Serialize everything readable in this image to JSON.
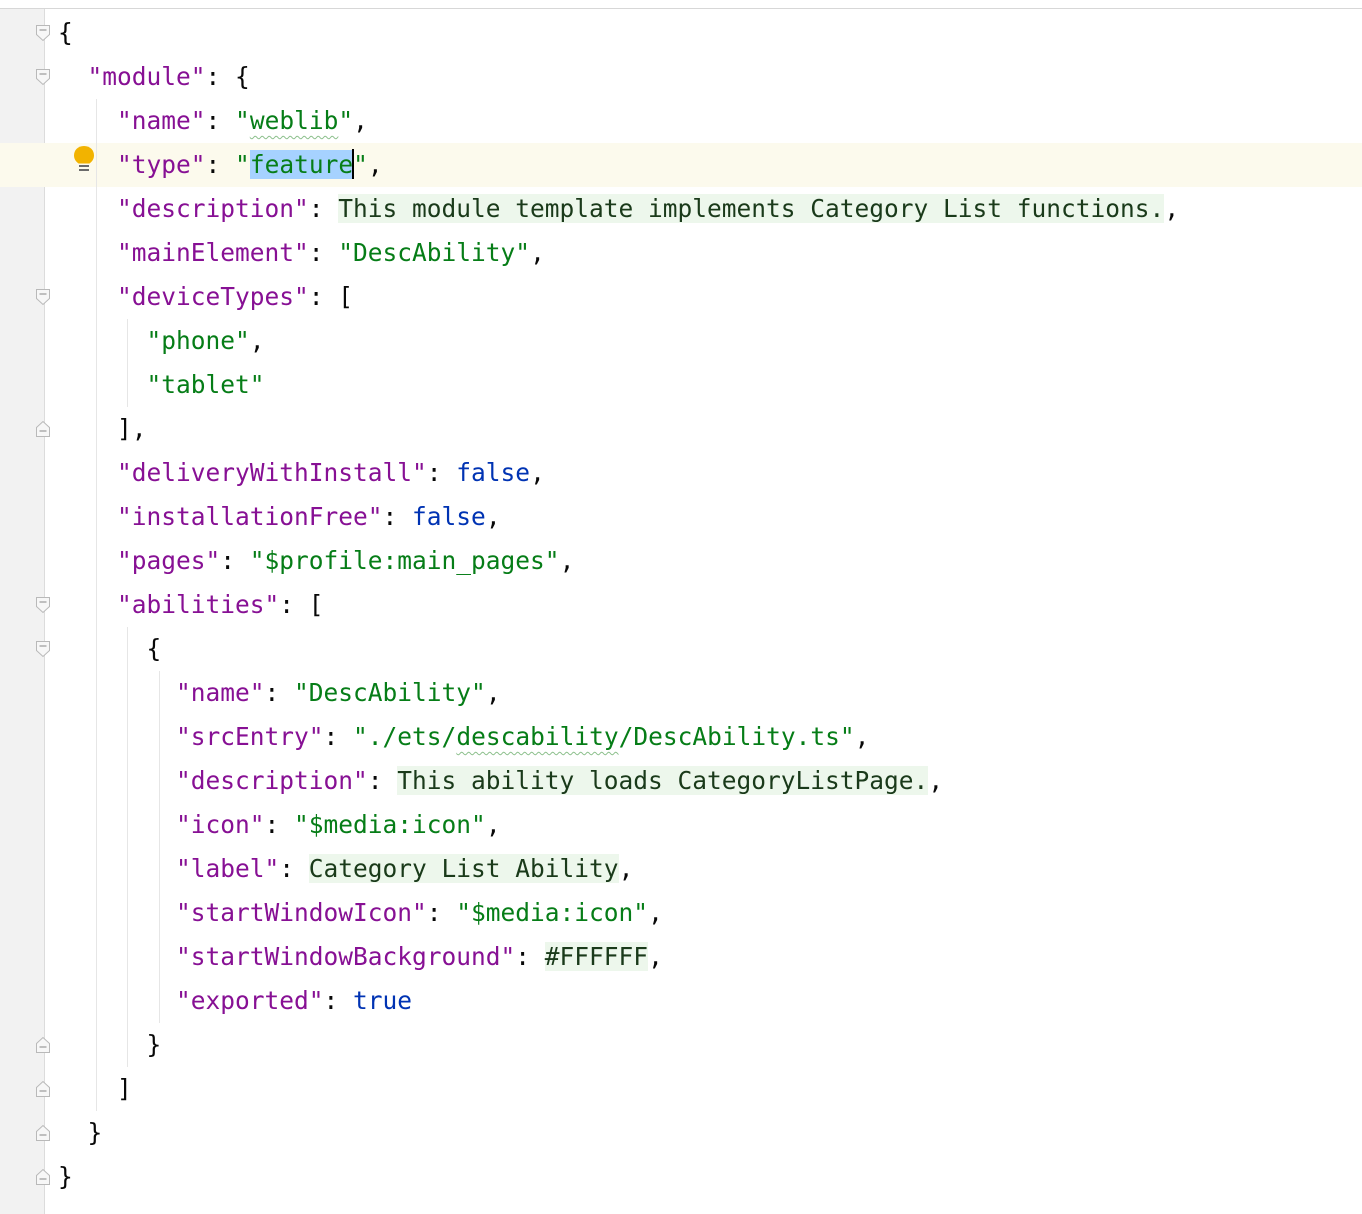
{
  "editor": {
    "file_type": "json5",
    "lines": [
      {
        "tokens": [
          {
            "t": "{",
            "c": "p"
          }
        ]
      },
      {
        "tokens": [
          {
            "t": "  ",
            "c": "p"
          },
          {
            "t": "\"module\"",
            "c": "k"
          },
          {
            "t": ": {",
            "c": "p"
          }
        ]
      },
      {
        "tokens": [
          {
            "t": "    ",
            "c": "p"
          },
          {
            "t": "\"name\"",
            "c": "k"
          },
          {
            "t": ": ",
            "c": "p"
          },
          {
            "t": "\"",
            "c": "s"
          },
          {
            "t": "weblib",
            "c": "s squig"
          },
          {
            "t": "\"",
            "c": "s"
          },
          {
            "t": ",",
            "c": "p"
          }
        ]
      },
      {
        "tokens": [
          {
            "t": "    ",
            "c": "p"
          },
          {
            "t": "\"type\"",
            "c": "k"
          },
          {
            "t": ": ",
            "c": "p"
          },
          {
            "t": "\"",
            "c": "s"
          },
          {
            "t": "feature",
            "c": "s sel"
          },
          {
            "t": "",
            "c": "caret"
          },
          {
            "t": "\"",
            "c": "s"
          },
          {
            "t": ",",
            "c": "p"
          }
        ]
      },
      {
        "tokens": [
          {
            "t": "    ",
            "c": "p"
          },
          {
            "t": "\"description\"",
            "c": "k"
          },
          {
            "t": ": ",
            "c": "p"
          },
          {
            "t": "This module template implements Category List functions.",
            "c": "inj"
          },
          {
            "t": ",",
            "c": "p"
          }
        ]
      },
      {
        "tokens": [
          {
            "t": "    ",
            "c": "p"
          },
          {
            "t": "\"mainElement\"",
            "c": "k"
          },
          {
            "t": ": ",
            "c": "p"
          },
          {
            "t": "\"DescAbility\"",
            "c": "s"
          },
          {
            "t": ",",
            "c": "p"
          }
        ]
      },
      {
        "tokens": [
          {
            "t": "    ",
            "c": "p"
          },
          {
            "t": "\"deviceTypes\"",
            "c": "k"
          },
          {
            "t": ": [",
            "c": "p"
          }
        ]
      },
      {
        "tokens": [
          {
            "t": "      ",
            "c": "p"
          },
          {
            "t": "\"phone\"",
            "c": "s"
          },
          {
            "t": ",",
            "c": "p"
          }
        ]
      },
      {
        "tokens": [
          {
            "t": "      ",
            "c": "p"
          },
          {
            "t": "\"tablet\"",
            "c": "s"
          }
        ]
      },
      {
        "tokens": [
          {
            "t": "    ],",
            "c": "p"
          }
        ]
      },
      {
        "tokens": [
          {
            "t": "    ",
            "c": "p"
          },
          {
            "t": "\"deliveryWithInstall\"",
            "c": "k"
          },
          {
            "t": ": ",
            "c": "p"
          },
          {
            "t": "false",
            "c": "b"
          },
          {
            "t": ",",
            "c": "p"
          }
        ]
      },
      {
        "tokens": [
          {
            "t": "    ",
            "c": "p"
          },
          {
            "t": "\"installationFree\"",
            "c": "k"
          },
          {
            "t": ": ",
            "c": "p"
          },
          {
            "t": "false",
            "c": "b"
          },
          {
            "t": ",",
            "c": "p"
          }
        ]
      },
      {
        "tokens": [
          {
            "t": "    ",
            "c": "p"
          },
          {
            "t": "\"pages\"",
            "c": "k"
          },
          {
            "t": ": ",
            "c": "p"
          },
          {
            "t": "\"$profile:main_pages\"",
            "c": "s"
          },
          {
            "t": ",",
            "c": "p"
          }
        ]
      },
      {
        "tokens": [
          {
            "t": "    ",
            "c": "p"
          },
          {
            "t": "\"abilities\"",
            "c": "k"
          },
          {
            "t": ": [",
            "c": "p"
          }
        ]
      },
      {
        "tokens": [
          {
            "t": "      {",
            "c": "p"
          }
        ]
      },
      {
        "tokens": [
          {
            "t": "        ",
            "c": "p"
          },
          {
            "t": "\"name\"",
            "c": "k"
          },
          {
            "t": ": ",
            "c": "p"
          },
          {
            "t": "\"DescAbility\"",
            "c": "s"
          },
          {
            "t": ",",
            "c": "p"
          }
        ]
      },
      {
        "tokens": [
          {
            "t": "        ",
            "c": "p"
          },
          {
            "t": "\"srcEntry\"",
            "c": "k"
          },
          {
            "t": ": ",
            "c": "p"
          },
          {
            "t": "\"./ets/",
            "c": "s"
          },
          {
            "t": "descability",
            "c": "s squig"
          },
          {
            "t": "/DescAbility.ts\"",
            "c": "s"
          },
          {
            "t": ",",
            "c": "p"
          }
        ]
      },
      {
        "tokens": [
          {
            "t": "        ",
            "c": "p"
          },
          {
            "t": "\"description\"",
            "c": "k"
          },
          {
            "t": ": ",
            "c": "p"
          },
          {
            "t": "This ability loads CategoryListPage.",
            "c": "inj"
          },
          {
            "t": ",",
            "c": "p"
          }
        ]
      },
      {
        "tokens": [
          {
            "t": "        ",
            "c": "p"
          },
          {
            "t": "\"icon\"",
            "c": "k"
          },
          {
            "t": ": ",
            "c": "p"
          },
          {
            "t": "\"$media:icon\"",
            "c": "s"
          },
          {
            "t": ",",
            "c": "p"
          }
        ]
      },
      {
        "tokens": [
          {
            "t": "        ",
            "c": "p"
          },
          {
            "t": "\"label\"",
            "c": "k"
          },
          {
            "t": ": ",
            "c": "p"
          },
          {
            "t": "Category List Ability",
            "c": "inj"
          },
          {
            "t": ",",
            "c": "p"
          }
        ]
      },
      {
        "tokens": [
          {
            "t": "        ",
            "c": "p"
          },
          {
            "t": "\"startWindowIcon\"",
            "c": "k"
          },
          {
            "t": ": ",
            "c": "p"
          },
          {
            "t": "\"$media:icon\"",
            "c": "s"
          },
          {
            "t": ",",
            "c": "p"
          }
        ]
      },
      {
        "tokens": [
          {
            "t": "        ",
            "c": "p"
          },
          {
            "t": "\"startWindowBackground\"",
            "c": "k"
          },
          {
            "t": ": ",
            "c": "p"
          },
          {
            "t": "#FFFFFF",
            "c": "inj"
          },
          {
            "t": ",",
            "c": "p"
          }
        ]
      },
      {
        "tokens": [
          {
            "t": "        ",
            "c": "p"
          },
          {
            "t": "\"exported\"",
            "c": "k"
          },
          {
            "t": ": ",
            "c": "p"
          },
          {
            "t": "true",
            "c": "b"
          }
        ]
      },
      {
        "tokens": [
          {
            "t": "      }",
            "c": "p"
          }
        ]
      },
      {
        "tokens": [
          {
            "t": "    ]",
            "c": "p"
          }
        ]
      },
      {
        "tokens": [
          {
            "t": "  }",
            "c": "p"
          }
        ]
      },
      {
        "tokens": [
          {
            "t": "}",
            "c": "p"
          }
        ]
      }
    ],
    "fold_markers": [
      {
        "line": 0,
        "kind": "open"
      },
      {
        "line": 1,
        "kind": "open"
      },
      {
        "line": 6,
        "kind": "open"
      },
      {
        "line": 9,
        "kind": "close"
      },
      {
        "line": 13,
        "kind": "open"
      },
      {
        "line": 14,
        "kind": "open"
      },
      {
        "line": 23,
        "kind": "close"
      },
      {
        "line": 24,
        "kind": "close"
      },
      {
        "line": 25,
        "kind": "close"
      },
      {
        "line": 26,
        "kind": "close"
      }
    ],
    "indent_guides": [
      {
        "col": 2,
        "from": 2,
        "to": 25
      },
      {
        "col": 4,
        "from": 7,
        "to": 9
      },
      {
        "col": 4,
        "from": 14,
        "to": 24
      },
      {
        "col": 6,
        "from": 15,
        "to": 23
      }
    ],
    "caret_line": 3,
    "intention_icon": "lightbulb-icon",
    "colors": {
      "key": "#871094",
      "string": "#067d17",
      "keyword": "#0033b3",
      "injected_background": "#edf7ec",
      "selection": "#a6d2ff",
      "current_line": "#fcfaed"
    }
  }
}
